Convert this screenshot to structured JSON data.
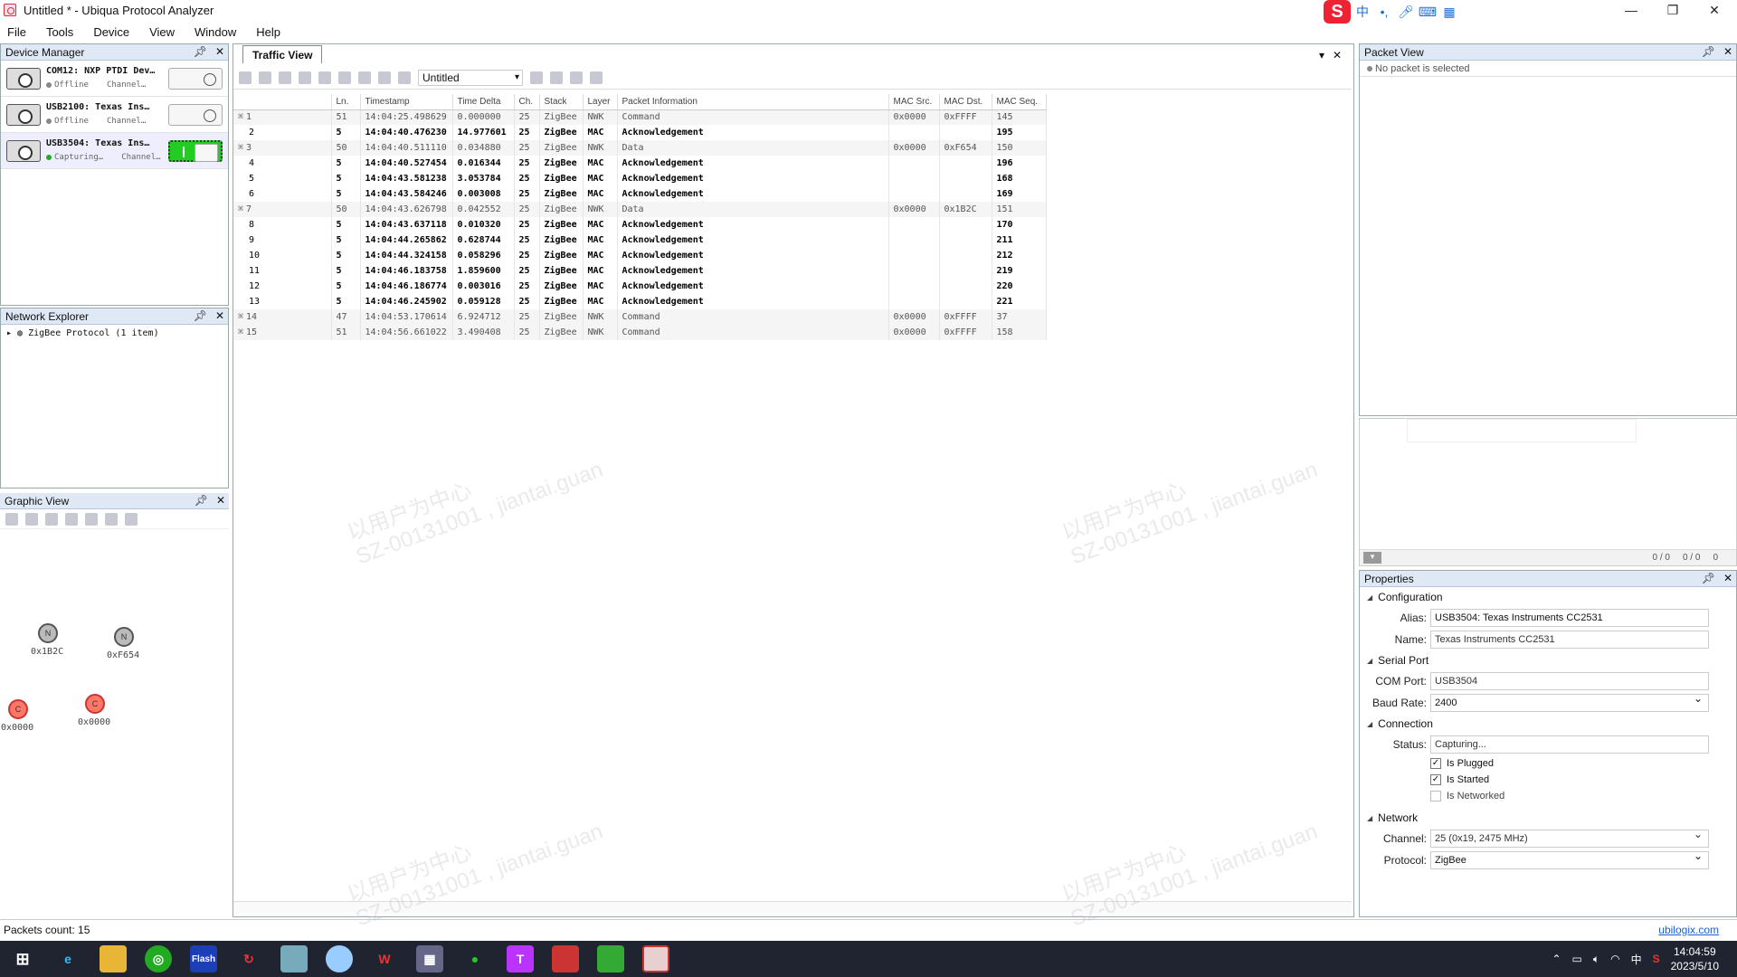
{
  "window": {
    "title": "Untitled * - Ubiqua Protocol Analyzer"
  },
  "menu": [
    "File",
    "Tools",
    "Device",
    "View",
    "Window",
    "Help"
  ],
  "device_manager": {
    "title": "Device Manager",
    "devices": [
      {
        "name": "COM12: NXP PTDI Dev…",
        "status": "Offline",
        "channel": "Channel…",
        "on": false
      },
      {
        "name": "USB2100: Texas Ins…",
        "status": "Offline",
        "channel": "Channel…",
        "on": false
      },
      {
        "name": "USB3504: Texas Ins…",
        "status": "Capturing…",
        "channel": "Channel…",
        "on": true
      }
    ]
  },
  "network_explorer": {
    "title": "Network Explorer",
    "item": "ZigBee Protocol (1 item)"
  },
  "graphic_view": {
    "title": "Graphic View",
    "nodes": [
      {
        "label": "0x1B2C",
        "glyph": "N"
      },
      {
        "label": "0xF654",
        "glyph": "N"
      },
      {
        "label": "0x0000",
        "glyph": "C"
      },
      {
        "label": "0x0000",
        "glyph": "C"
      }
    ]
  },
  "traffic_view": {
    "tab": "Traffic View",
    "filter": "Untitled",
    "columns": [
      "",
      "Ln.",
      "Timestamp",
      "Time Delta",
      "Ch.",
      "Stack",
      "Layer",
      "Packet Information",
      "MAC Src.",
      "MAC Dst.",
      "MAC Seq."
    ],
    "rows": [
      {
        "idx": "1",
        "ln": "51",
        "ts": "14:04:25.498629",
        "dt": "0.000000",
        "ch": "25",
        "stack": "ZigBee",
        "layer": "NWK",
        "info": "Command",
        "src": "0x0000",
        "dst": "0xFFFF",
        "seq": "145",
        "tree": true
      },
      {
        "idx": "2",
        "ln": "5",
        "ts": "14:04:40.476230",
        "dt": "14.977601",
        "ch": "25",
        "stack": "ZigBee",
        "layer": "MAC",
        "info": "Acknowledgement",
        "src": "",
        "dst": "",
        "seq": "195",
        "tree": false
      },
      {
        "idx": "3",
        "ln": "50",
        "ts": "14:04:40.511110",
        "dt": "0.034880",
        "ch": "25",
        "stack": "ZigBee",
        "layer": "NWK",
        "info": "Data",
        "src": "0x0000",
        "dst": "0xF654",
        "seq": "150",
        "tree": true
      },
      {
        "idx": "4",
        "ln": "5",
        "ts": "14:04:40.527454",
        "dt": "0.016344",
        "ch": "25",
        "stack": "ZigBee",
        "layer": "MAC",
        "info": "Acknowledgement",
        "src": "",
        "dst": "",
        "seq": "196",
        "tree": false
      },
      {
        "idx": "5",
        "ln": "5",
        "ts": "14:04:43.581238",
        "dt": "3.053784",
        "ch": "25",
        "stack": "ZigBee",
        "layer": "MAC",
        "info": "Acknowledgement",
        "src": "",
        "dst": "",
        "seq": "168",
        "tree": false
      },
      {
        "idx": "6",
        "ln": "5",
        "ts": "14:04:43.584246",
        "dt": "0.003008",
        "ch": "25",
        "stack": "ZigBee",
        "layer": "MAC",
        "info": "Acknowledgement",
        "src": "",
        "dst": "",
        "seq": "169",
        "tree": false
      },
      {
        "idx": "7",
        "ln": "50",
        "ts": "14:04:43.626798",
        "dt": "0.042552",
        "ch": "25",
        "stack": "ZigBee",
        "layer": "NWK",
        "info": "Data",
        "src": "0x0000",
        "dst": "0x1B2C",
        "seq": "151",
        "tree": true
      },
      {
        "idx": "8",
        "ln": "5",
        "ts": "14:04:43.637118",
        "dt": "0.010320",
        "ch": "25",
        "stack": "ZigBee",
        "layer": "MAC",
        "info": "Acknowledgement",
        "src": "",
        "dst": "",
        "seq": "170",
        "tree": false
      },
      {
        "idx": "9",
        "ln": "5",
        "ts": "14:04:44.265862",
        "dt": "0.628744",
        "ch": "25",
        "stack": "ZigBee",
        "layer": "MAC",
        "info": "Acknowledgement",
        "src": "",
        "dst": "",
        "seq": "211",
        "tree": false
      },
      {
        "idx": "10",
        "ln": "5",
        "ts": "14:04:44.324158",
        "dt": "0.058296",
        "ch": "25",
        "stack": "ZigBee",
        "layer": "MAC",
        "info": "Acknowledgement",
        "src": "",
        "dst": "",
        "seq": "212",
        "tree": false
      },
      {
        "idx": "11",
        "ln": "5",
        "ts": "14:04:46.183758",
        "dt": "1.859600",
        "ch": "25",
        "stack": "ZigBee",
        "layer": "MAC",
        "info": "Acknowledgement",
        "src": "",
        "dst": "",
        "seq": "219",
        "tree": false
      },
      {
        "idx": "12",
        "ln": "5",
        "ts": "14:04:46.186774",
        "dt": "0.003016",
        "ch": "25",
        "stack": "ZigBee",
        "layer": "MAC",
        "info": "Acknowledgement",
        "src": "",
        "dst": "",
        "seq": "220",
        "tree": false
      },
      {
        "idx": "13",
        "ln": "5",
        "ts": "14:04:46.245902",
        "dt": "0.059128",
        "ch": "25",
        "stack": "ZigBee",
        "layer": "MAC",
        "info": "Acknowledgement",
        "src": "",
        "dst": "",
        "seq": "221",
        "tree": false
      },
      {
        "idx": "14",
        "ln": "47",
        "ts": "14:04:53.170614",
        "dt": "6.924712",
        "ch": "25",
        "stack": "ZigBee",
        "layer": "NWK",
        "info": "Command",
        "src": "0x0000",
        "dst": "0xFFFF",
        "seq": "37",
        "tree": true
      },
      {
        "idx": "15",
        "ln": "51",
        "ts": "14:04:56.661022",
        "dt": "3.490408",
        "ch": "25",
        "stack": "ZigBee",
        "layer": "NWK",
        "info": "Command",
        "src": "0x0000",
        "dst": "0xFFFF",
        "seq": "158",
        "tree": true
      }
    ]
  },
  "packet_view": {
    "title": "Packet View",
    "empty_msg": "No packet is selected",
    "counts": [
      "0 / 0",
      "0 / 0",
      "0"
    ]
  },
  "properties": {
    "title": "Properties",
    "config": {
      "header": "Configuration",
      "alias_label": "Alias:",
      "alias": "USB3504: Texas Instruments CC2531",
      "name_label": "Name:",
      "name": "Texas Instruments CC2531"
    },
    "serial": {
      "header": "Serial Port",
      "com_label": "COM Port:",
      "com": "USB3504",
      "baud_label": "Baud Rate:",
      "baud": "2400"
    },
    "connection": {
      "header": "Connection",
      "status_label": "Status:",
      "status": "Capturing...",
      "plugged": "Is Plugged",
      "started": "Is Started",
      "networked": "Is Networked"
    },
    "network": {
      "header": "Network",
      "channel_label": "Channel:",
      "channel": "25 (0x19, 2475 MHz)",
      "protocol_label": "Protocol:",
      "protocol": "ZigBee"
    }
  },
  "status_bar": {
    "packets": "Packets count: 15",
    "link": "ubilogix.com"
  },
  "taskbar": {
    "time": "14:04:59",
    "date": "2023/5/10",
    "ime": "中"
  },
  "watermark": {
    "line1": "以用户为中心",
    "line2": "SZ-00131001 , jiantai.guan"
  }
}
